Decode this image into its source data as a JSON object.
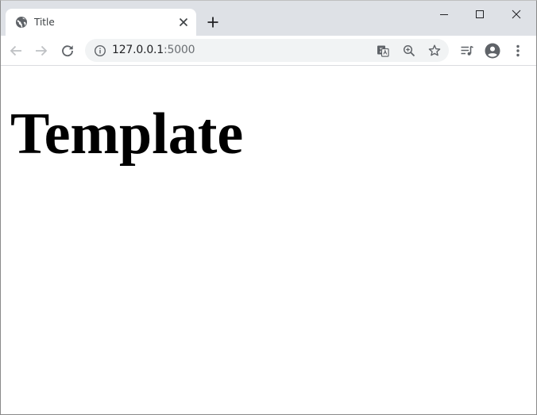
{
  "browser": {
    "tab": {
      "title": "Title",
      "favicon": "globe-icon"
    },
    "new_tab_icon": "plus-icon",
    "window_controls": [
      "minimize-icon",
      "maximize-icon",
      "close-icon"
    ],
    "nav": [
      "back-arrow-icon",
      "forward-arrow-icon",
      "reload-icon"
    ],
    "address": {
      "host": "127.0.0.1",
      "port": ":5000",
      "security_icon": "info-icon"
    },
    "omnibox_actions": [
      "translate-icon",
      "zoom-icon",
      "bookmark-star-icon"
    ],
    "toolbar_actions": [
      "media-control-icon",
      "profile-icon",
      "menu-dots-icon"
    ]
  },
  "page": {
    "heading": "Template"
  },
  "colors": {
    "tabstrip": "#dee1e6",
    "omnibox": "#f1f3f4",
    "icon": "#5f6368"
  }
}
